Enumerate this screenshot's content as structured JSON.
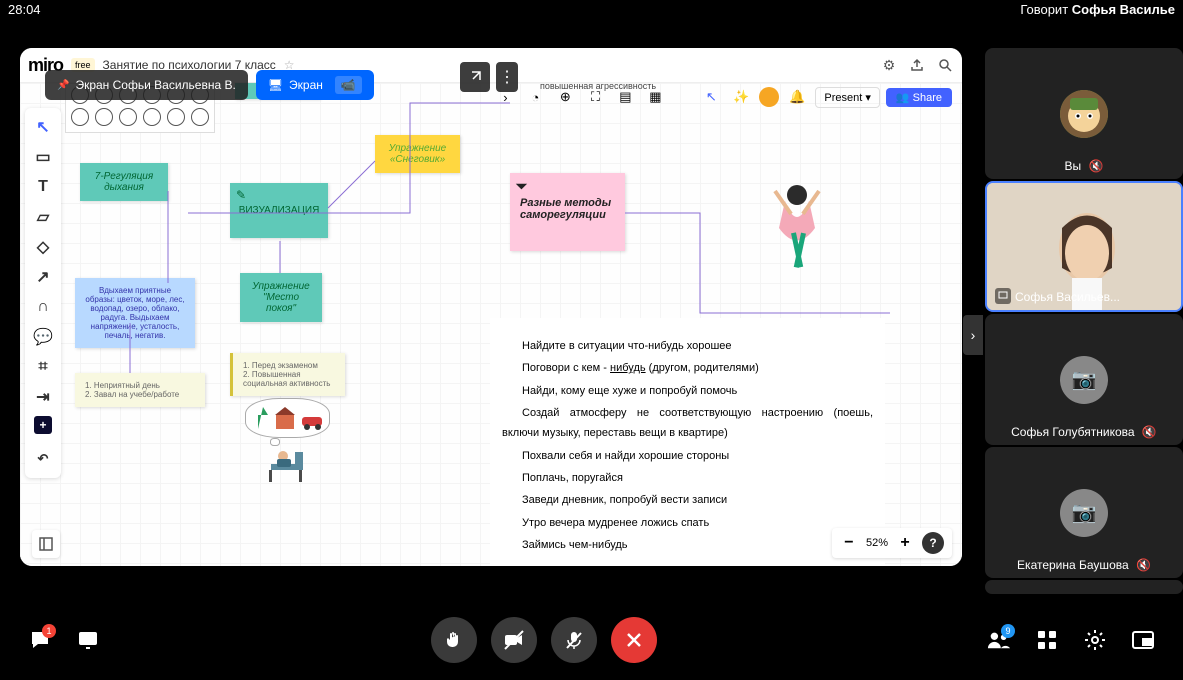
{
  "topbar": {
    "time": "28:04",
    "speaker_label": "Говорит",
    "speaker_name": "Софья Василье"
  },
  "share_labels": {
    "pinned": "Экран Софьи Васильевна В.",
    "screen": "Экран"
  },
  "miro": {
    "logo": "miro",
    "free": "free",
    "title": "Занятие по психологии 7 класс",
    "present": "Present",
    "share": "Share",
    "zoom": "52%"
  },
  "stickies": {
    "breathing": "7-Регуляция дыхания",
    "images": "Вдыхаем приятные образы: цветок, море, лес, водопад, озеро, облако, радуга. Выдыхаем напряжение, усталость, печаль, негатив.",
    "visualization": "ВИЗУАЛИЗАЦИЯ",
    "snowman": "Упражнение «Снеговик»",
    "peace": "Упражнение \"Место покоя\"",
    "methods": "Разные методы саморегуляции",
    "notes1": "1. Перед экзаменом",
    "notes2": "2. Повышенная социальная активность",
    "day1": "1. Неприятный день",
    "day2": "2. Завал на учебе/работе",
    "aggressive": "повышенная агрессивность"
  },
  "text_block": {
    "l1a": "Найдите в ситуации что-нибудь хорошее",
    "l2a": "Поговори с кем - ",
    "l2b": "нибудь",
    "l2c": " (другом, родителями)",
    "l3": "Найди, кому еще хуже и попробуй помочь",
    "l4": "Создай атмосферу не соответствующую настроению (поешь, включи музыку, переставь вещи в квартире)",
    "l5": "Похвали себя и найди хорошие стороны",
    "l6": "Поплачь, поругайся",
    "l7": "Заведи дневник, попробуй вести записи",
    "l8": "Утро вечера мудренее ложись спать",
    "l9": "Займись чем-нибудь"
  },
  "participants": {
    "p1": "Вы",
    "p2": "Софья Васильев...",
    "p3": "Софья Голубятникова",
    "p4": "Екатерина Баушова"
  },
  "badges": {
    "chat": "1",
    "people": "9"
  }
}
